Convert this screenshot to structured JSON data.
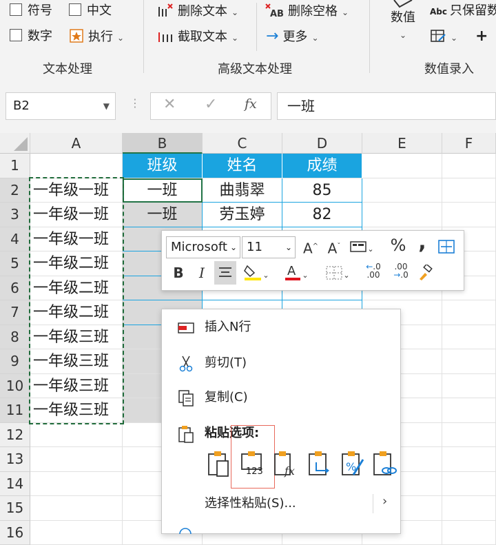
{
  "ribbon": {
    "text_group": {
      "symbol": "符号",
      "chinese": "中文",
      "number": "数字",
      "execute": "执行",
      "label": "文本处理"
    },
    "advanced_group": {
      "delete_text": "删除文本",
      "extract_text": "截取文本",
      "delete_space": "删除空格",
      "more": "更多",
      "label": "高级文本处理"
    },
    "value_group": {
      "value": "数值",
      "keep_only": "只保留数",
      "abc": "Abc",
      "label": "数值录入"
    }
  },
  "formula_bar": {
    "name_box": "B2",
    "fx": "fx",
    "content": "一班"
  },
  "columns": [
    "A",
    "B",
    "C",
    "D",
    "E",
    "F"
  ],
  "rows": [
    "1",
    "2",
    "3",
    "4",
    "5",
    "6",
    "7",
    "8",
    "9",
    "10",
    "11",
    "12",
    "13",
    "14",
    "15",
    "16"
  ],
  "table": {
    "headers": [
      "班级",
      "姓名",
      "成绩"
    ],
    "col_a": [
      "一年级一班",
      "一年级一班",
      "一年级一班",
      "一年级二班",
      "一年级二班",
      "一年级二班",
      "一年级三班",
      "一年级三班",
      "一年级三班",
      "一年级三班"
    ],
    "col_b_visible": [
      "一班",
      "一班"
    ],
    "col_c_visible": [
      "曲翡翠",
      "劳玉婷"
    ],
    "col_d_visible": [
      "85",
      "82"
    ]
  },
  "mini_toolbar": {
    "font_name": "Microsoft",
    "font_size": "11",
    "bold": "B",
    "italic": "I",
    "percent": "%",
    "comma": ","
  },
  "context_menu": {
    "insert_rows": "插入N行",
    "cut": "剪切(T)",
    "copy": "复制(C)",
    "paste_options": "粘贴选项:",
    "paste_special": "选择性粘贴(S)...",
    "paste_values_text": "123"
  },
  "colors": {
    "header_blue": "#1aa4e0",
    "marching_ants": "#1f6b3a",
    "selection_gray": "#dadada",
    "paste_highlight": "#e8685a"
  }
}
